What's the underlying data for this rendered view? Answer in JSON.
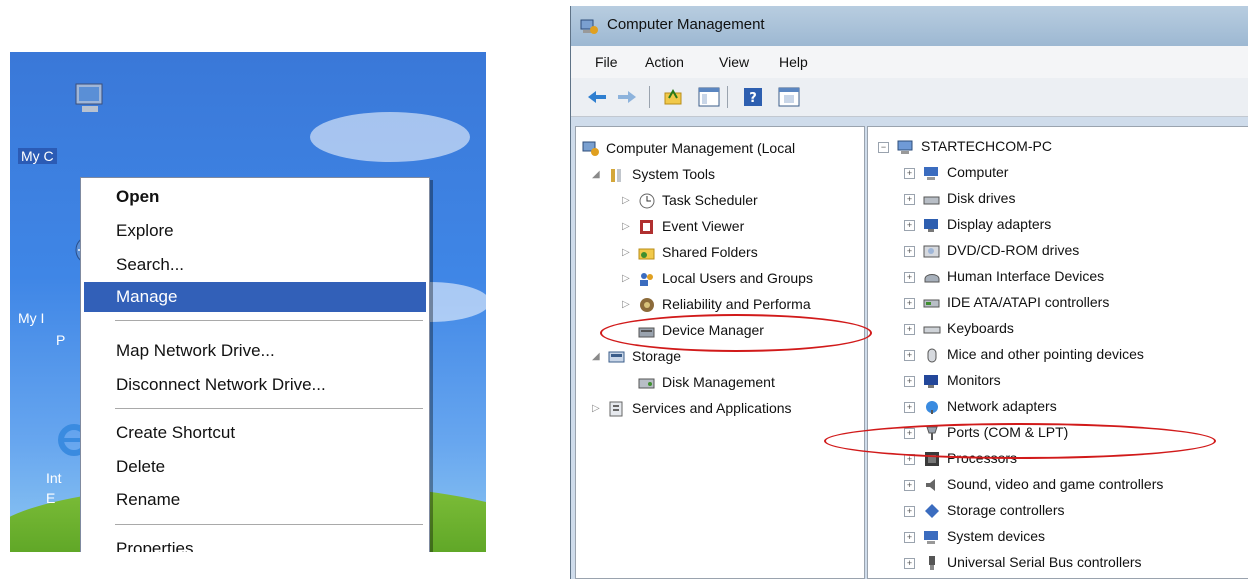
{
  "desktop": {
    "icon_labels": [
      "My C",
      "My I",
      "P",
      "Int",
      "E"
    ]
  },
  "context_menu": {
    "items": [
      {
        "label": "Open",
        "bold": true
      },
      {
        "label": "Explore"
      },
      {
        "label": "Search..."
      },
      {
        "label": "Manage",
        "highlighted": true
      },
      {
        "label": "Map Network Drive..."
      },
      {
        "label": "Disconnect Network Drive..."
      },
      {
        "label": "Create Shortcut"
      },
      {
        "label": "Delete"
      },
      {
        "label": "Rename"
      },
      {
        "label": "Properties"
      }
    ]
  },
  "window": {
    "title": "Computer Management",
    "menu": [
      "File",
      "Action",
      "View",
      "Help"
    ],
    "toolbar_icons": [
      "back-arrow-icon",
      "forward-arrow-icon",
      "up-folder-icon",
      "show-hide-tree-icon",
      "help-icon",
      "properties-icon"
    ]
  },
  "left_tree": {
    "root": "Computer Management (Local",
    "items": [
      {
        "label": "System Tools"
      },
      {
        "label": "Task Scheduler"
      },
      {
        "label": "Event Viewer"
      },
      {
        "label": "Shared Folders"
      },
      {
        "label": "Local Users and Groups"
      },
      {
        "label": "Reliability and Performa"
      },
      {
        "label": "Device Manager",
        "circled": true
      },
      {
        "label": "Storage"
      },
      {
        "label": "Disk Management"
      },
      {
        "label": "Services and Applications"
      }
    ]
  },
  "right_tree": {
    "root": "STARTECHCOM-PC",
    "items": [
      {
        "label": "Computer"
      },
      {
        "label": "Disk drives"
      },
      {
        "label": "Display adapters"
      },
      {
        "label": "DVD/CD-ROM drives"
      },
      {
        "label": "Human Interface Devices"
      },
      {
        "label": "IDE ATA/ATAPI controllers"
      },
      {
        "label": "Keyboards"
      },
      {
        "label": "Mice and other pointing devices"
      },
      {
        "label": "Monitors"
      },
      {
        "label": "Network adapters"
      },
      {
        "label": "Ports (COM & LPT)",
        "circled": true
      },
      {
        "label": "Processors"
      },
      {
        "label": "Sound, video and game controllers"
      },
      {
        "label": "Storage controllers"
      },
      {
        "label": "System devices"
      },
      {
        "label": "Universal Serial Bus controllers"
      }
    ]
  },
  "colors": {
    "highlight": "#3260b8",
    "annotation_ring": "#d11a1a",
    "desktop_sky": "#3f86e6"
  }
}
